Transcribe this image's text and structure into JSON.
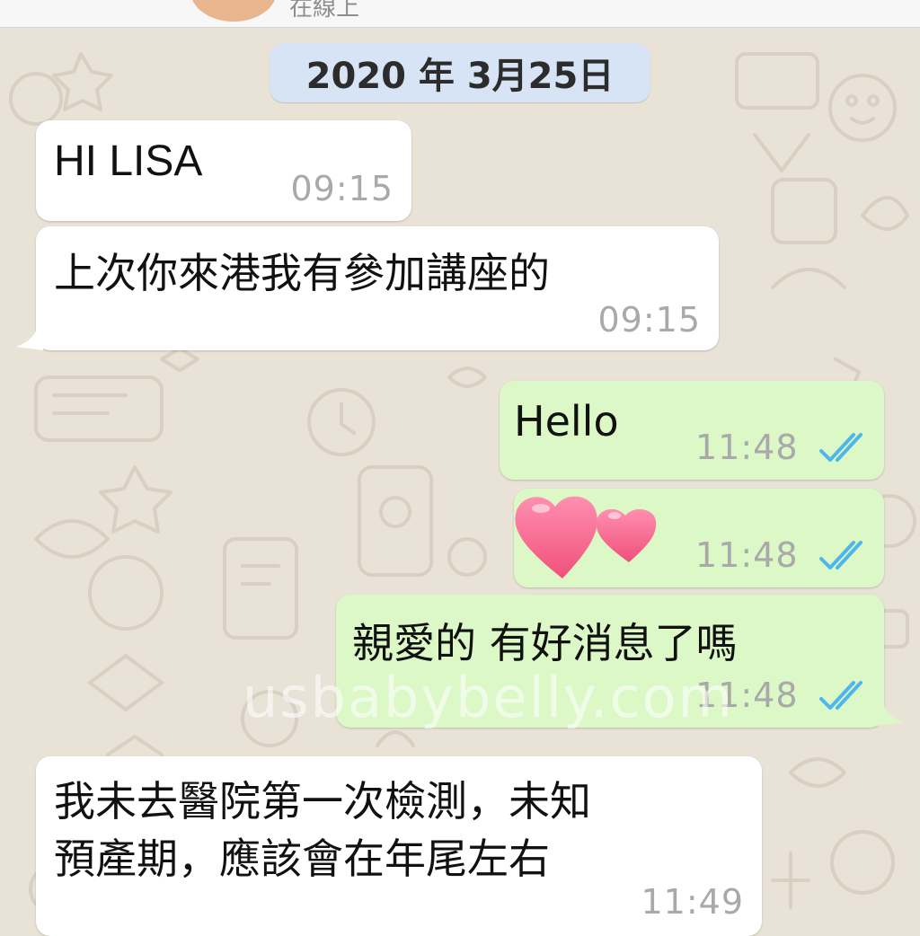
{
  "header": {
    "status": "在線上"
  },
  "date_divider": "2020 年 3月25日",
  "messages": [
    {
      "direction": "incoming",
      "text": "HI LISA",
      "time": "09:15"
    },
    {
      "direction": "incoming",
      "text": "上次你來港我有參加講座的",
      "time": "09:15"
    },
    {
      "direction": "outgoing",
      "text": "Hello",
      "time": "11:48",
      "read": true
    },
    {
      "direction": "outgoing",
      "sticker": "two-hearts",
      "time": "11:48",
      "read": true
    },
    {
      "direction": "outgoing",
      "text": "親愛的 有好消息了嗎",
      "time": "11:48",
      "read": true
    },
    {
      "direction": "incoming",
      "lines": [
        "我未去醫院第一次檢測，未知",
        "預產期，應該會在年尾左右"
      ],
      "time": "11:49"
    }
  ],
  "watermark": "usbabybelly.com",
  "colors": {
    "wallpaper": "#e9e2d6",
    "incoming_bubble": "#ffffff",
    "outgoing_bubble": "#dcf8c6",
    "date_pill": "#d6e4f6",
    "read_ticks": "#4fb6ec",
    "timestamp": "#a9a9a9",
    "heart": "#f4668f"
  },
  "icons": [
    "double-check-icon",
    "heart-sticker"
  ]
}
